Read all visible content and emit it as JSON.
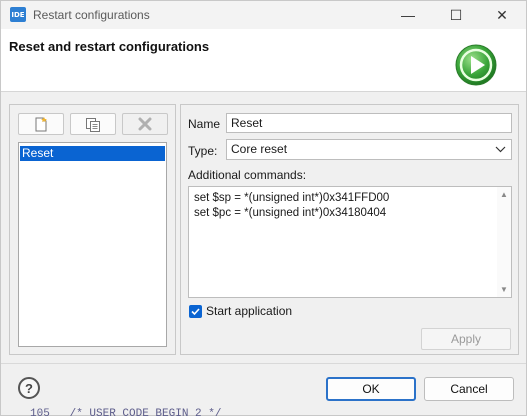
{
  "window": {
    "app_icon_text": "IDE",
    "title": "Restart configurations",
    "minimize_glyph": "—",
    "maximize_glyph": "☐",
    "close_glyph": "✕"
  },
  "header": {
    "title": "Reset and restart configurations",
    "icon": "play-circle-icon"
  },
  "left_panel": {
    "toolbar": [
      {
        "name": "new-config-button",
        "icon": "new-document-icon"
      },
      {
        "name": "duplicate-config-button",
        "icon": "duplicate-icon"
      },
      {
        "name": "delete-config-button",
        "icon": "delete-x-icon"
      }
    ],
    "configs": [
      "Reset"
    ],
    "selected_index": 0
  },
  "right_panel": {
    "name_label": "Name",
    "name_value": "Reset",
    "type_label": "Type:",
    "type_value": "Core reset",
    "additional_commands_label": "Additional commands:",
    "commands": [
      "set $sp = *(unsigned int*)0x341FFD00",
      "set $pc = *(unsigned int*)0x34180404"
    ],
    "start_application_label": "Start application",
    "start_application_checked": true,
    "apply_label": "Apply"
  },
  "footer": {
    "help_glyph": "?",
    "ok_label": "OK",
    "cancel_label": "Cancel"
  },
  "background_text": "105   /* USER CODE BEGIN 2 */",
  "colors": {
    "selection": "#0a64d2",
    "accent": "#2b72c9",
    "play_green": "#3aa53a"
  }
}
